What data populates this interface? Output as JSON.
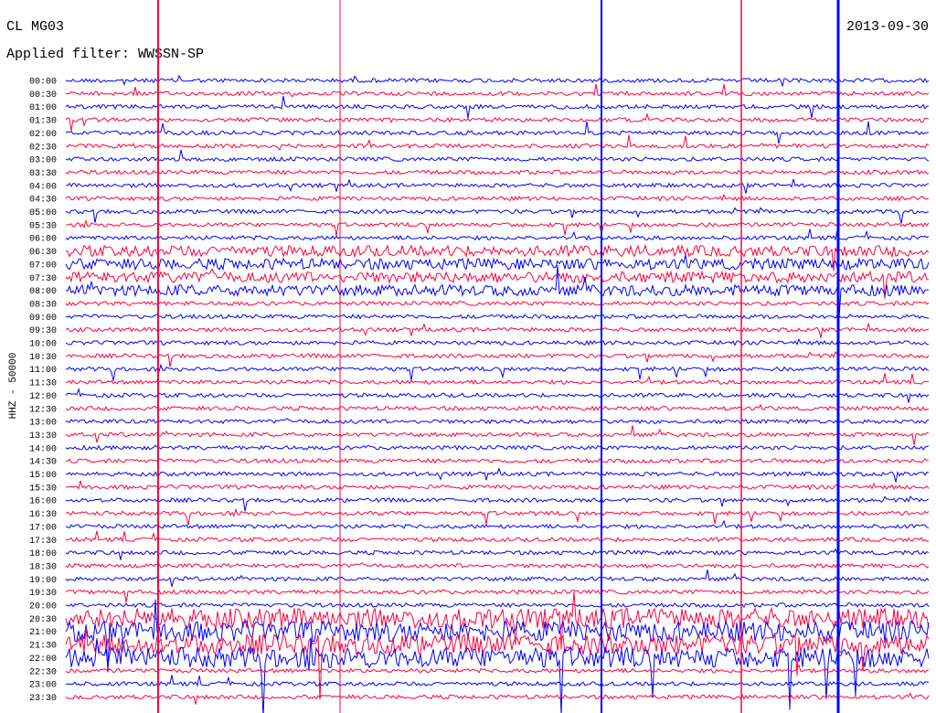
{
  "header": {
    "station": "CL MG03",
    "filter": "Applied filter: WWSSN-SP",
    "date": "2013-09-30"
  },
  "chart_data": {
    "type": "line",
    "title": "CL MG03",
    "subtitle": "Applied filter: WWSSN-SP",
    "date": "2013-09-30",
    "ylabel": "HHZ - 50000",
    "xlabel": "",
    "row_labels": [
      "00:00",
      "00:30",
      "01:00",
      "01:30",
      "02:00",
      "02:30",
      "03:00",
      "03:30",
      "04:00",
      "04:30",
      "05:00",
      "05:30",
      "06:00",
      "06:30",
      "07:00",
      "07:30",
      "08:00",
      "08:30",
      "09:00",
      "09:30",
      "10:00",
      "10:30",
      "11:00",
      "11:30",
      "12:00",
      "12:30",
      "13:00",
      "13:30",
      "14:00",
      "14:30",
      "15:00",
      "15:30",
      "16:00",
      "16:30",
      "17:00",
      "17:30",
      "18:00",
      "18:30",
      "19:00",
      "19:30",
      "20:00",
      "20:30",
      "21:00",
      "21:30",
      "22:00",
      "22:30",
      "23:00",
      "23:30"
    ],
    "trace_colors": [
      "#0000ff",
      "#ff0040"
    ],
    "grid": false,
    "legend": "none"
  }
}
